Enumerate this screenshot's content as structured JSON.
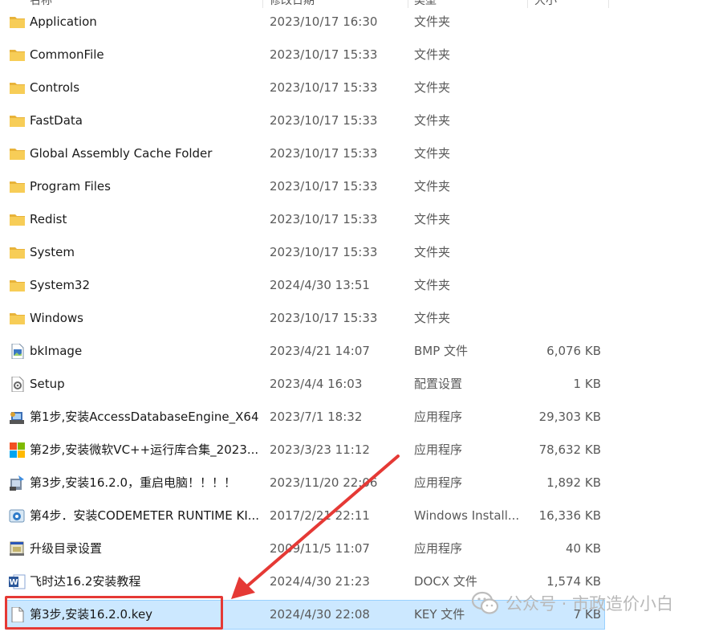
{
  "columns": [
    "名称",
    "修改日期",
    "类型",
    "大小"
  ],
  "rows": [
    {
      "name": "Application",
      "date": "2023/10/17 16:30",
      "type": "文件夹",
      "size": "",
      "icon": "folder-icon"
    },
    {
      "name": "CommonFile",
      "date": "2023/10/17 15:33",
      "type": "文件夹",
      "size": "",
      "icon": "folder-icon"
    },
    {
      "name": "Controls",
      "date": "2023/10/17 15:33",
      "type": "文件夹",
      "size": "",
      "icon": "folder-icon"
    },
    {
      "name": "FastData",
      "date": "2023/10/17 15:33",
      "type": "文件夹",
      "size": "",
      "icon": "folder-icon"
    },
    {
      "name": "Global Assembly Cache Folder",
      "date": "2023/10/17 15:33",
      "type": "文件夹",
      "size": "",
      "icon": "folder-icon"
    },
    {
      "name": "Program Files",
      "date": "2023/10/17 15:33",
      "type": "文件夹",
      "size": "",
      "icon": "folder-icon"
    },
    {
      "name": "Redist",
      "date": "2023/10/17 15:33",
      "type": "文件夹",
      "size": "",
      "icon": "folder-icon"
    },
    {
      "name": "System",
      "date": "2023/10/17 15:33",
      "type": "文件夹",
      "size": "",
      "icon": "folder-icon"
    },
    {
      "name": "System32",
      "date": "2024/4/30 13:51",
      "type": "文件夹",
      "size": "",
      "icon": "folder-icon"
    },
    {
      "name": "Windows",
      "date": "2023/10/17 15:33",
      "type": "文件夹",
      "size": "",
      "icon": "folder-icon"
    },
    {
      "name": "bkImage",
      "date": "2023/4/21 14:07",
      "type": "BMP 文件",
      "size": "6,076 KB",
      "icon": "image-file-icon"
    },
    {
      "name": "Setup",
      "date": "2023/4/4 16:03",
      "type": "配置设置",
      "size": "1 KB",
      "icon": "settings-file-icon"
    },
    {
      "name": "第1步,安装AccessDatabaseEngine_X64",
      "date": "2023/7/1 18:32",
      "type": "应用程序",
      "size": "29,303 KB",
      "icon": "installer-icon"
    },
    {
      "name": "第2步,安装微软VC++运行库合集_2023....",
      "date": "2023/3/23 11:12",
      "type": "应用程序",
      "size": "78,632 KB",
      "icon": "windows-logo-icon"
    },
    {
      "name": "第3步,安装16.2.0，重启电脑！！！！",
      "date": "2023/11/20 22:06",
      "type": "应用程序",
      "size": "1,892 KB",
      "icon": "setup-exe-icon"
    },
    {
      "name": "第4步．安装CODEMETER RUNTIME KI...",
      "date": "2017/2/21 22:11",
      "type": "Windows Install...",
      "size": "16,336 KB",
      "icon": "msi-package-icon"
    },
    {
      "name": "升级目录设置",
      "date": "2009/11/5 11:07",
      "type": "应用程序",
      "size": "40 KB",
      "icon": "app-window-icon"
    },
    {
      "name": "飞时达16.2安装教程",
      "date": "2024/4/30 21:23",
      "type": "DOCX 文件",
      "size": "1,574 KB",
      "icon": "word-doc-icon"
    },
    {
      "name": "第3步,安装16.2.0.key",
      "date": "2024/4/30 22:08",
      "type": "KEY 文件",
      "size": "7 KB",
      "icon": "blank-file-icon",
      "selected": true
    }
  ],
  "watermark": {
    "text": "公众号 · 市政造价小白"
  },
  "colors": {
    "selection": "#cce8ff",
    "highlight": "#e53935",
    "folder": "#f4c64e"
  }
}
